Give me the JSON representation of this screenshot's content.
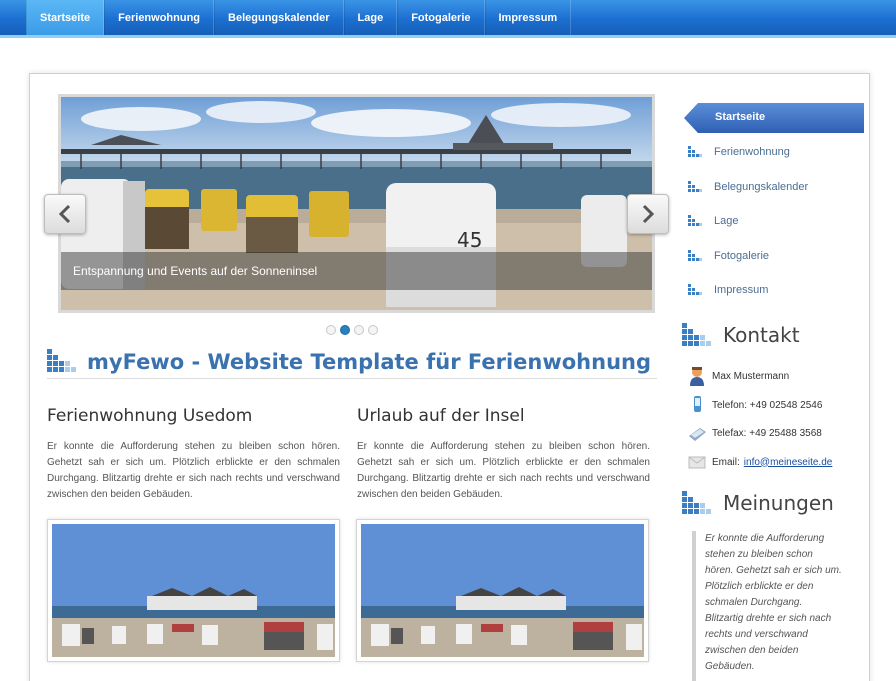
{
  "nav": {
    "items": [
      "Startseite",
      "Ferienwohnung",
      "Belegungskalender",
      "Lage",
      "Fotogalerie",
      "Impressum"
    ],
    "active": "Startseite"
  },
  "slider": {
    "caption": "Entspannung und Events auf der Sonneninsel",
    "slide_count": 4,
    "active_index": 1
  },
  "main": {
    "title": "myFewo - Website Template für Ferienwohnung",
    "col1": {
      "title": "Ferienwohnung Usedom",
      "text": "Er konnte die Aufforderung stehen zu bleiben schon hören. Gehetzt sah er sich um. Plötzlich erblickte er den schmalen Durchgang. Blitzartig drehte er sich nach rechts und verschwand zwischen den beiden Gebäuden."
    },
    "col2": {
      "title": "Urlaub auf der Insel",
      "text": "Er konnte die Aufforderung stehen zu bleiben schon hören. Gehetzt sah er sich um. Plötzlich erblickte er den schmalen Durchgang. Blitzartig drehte er sich nach rechts und verschwand zwischen den beiden Gebäuden."
    }
  },
  "sidebar": {
    "active": "Startseite",
    "items": [
      "Ferienwohnung",
      "Belegungskalender",
      "Lage",
      "Fotogalerie",
      "Impressum"
    ],
    "contact": {
      "title": "Kontakt",
      "name": "Max Mustermann",
      "phone": "Telefon: +49 02548 2546",
      "fax": "Telefax: +49 25488 3568",
      "email_label": "Email:",
      "email": "info@meineseite.de"
    },
    "opinions": {
      "title": "Meinungen",
      "text": "Er konnte die Aufforderung stehen zu bleiben schon hören. Gehetzt sah er sich um. Plötzlich erblickte er den schmalen Durchgang. Blitzartig drehte er sich nach rechts und verschwand zwischen den beiden Gebäuden."
    }
  },
  "colors": {
    "accent": "#1c6fd0",
    "heading_blue": "#3a72b0",
    "link": "#1a4fa0"
  },
  "icons": {
    "slider_prev": "chevron-left-icon",
    "slider_next": "chevron-right-icon",
    "heading": "blue-grid-icon",
    "contact_name": "person-icon",
    "contact_phone": "mobile-phone-icon",
    "contact_fax": "fax-icon",
    "contact_email": "envelope-icon"
  }
}
